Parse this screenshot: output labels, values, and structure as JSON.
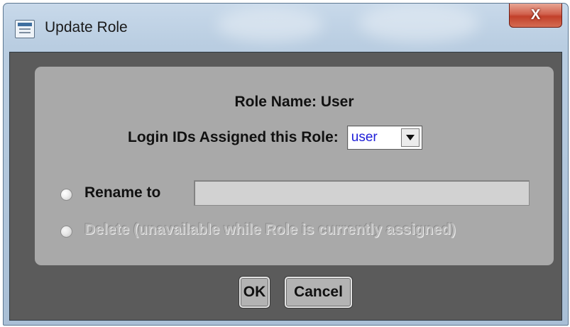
{
  "window": {
    "title": "Update Role",
    "close_label": "X"
  },
  "dialog": {
    "role_name_text": "Role Name: User",
    "login_ids_label": "Login IDs Assigned this Role:",
    "login_select_value": "user",
    "rename_label": "Rename to",
    "rename_value": "",
    "delete_label": "Delete (unavailable while Role is currently assigned)"
  },
  "buttons": {
    "ok": "OK",
    "cancel": "Cancel"
  },
  "colors": {
    "client_background": "#5b5b5b",
    "panel_background": "#a9a9a9",
    "select_text": "#1e1ed8",
    "close_button": "#c2402a"
  },
  "icons": {
    "window": "window-app-icon",
    "close": "close-icon",
    "dropdown": "chevron-down-icon"
  }
}
